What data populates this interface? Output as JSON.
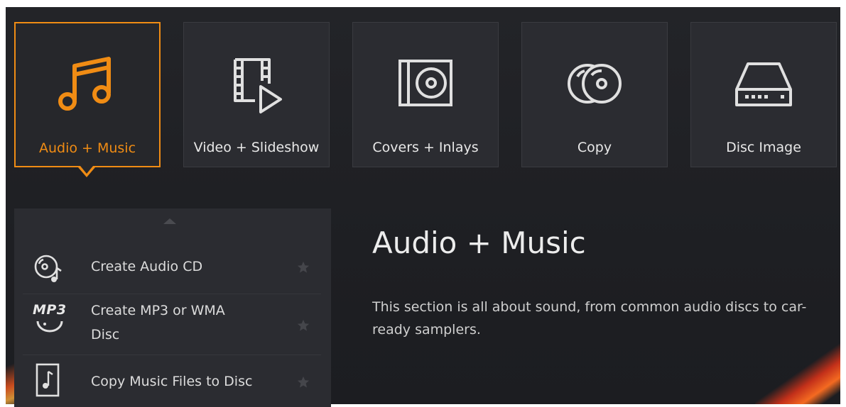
{
  "categories": [
    {
      "label": "Audio + Music",
      "icon": "music-notes-icon",
      "selected": true
    },
    {
      "label": "Video + Slideshow",
      "icon": "video-film-icon",
      "selected": false
    },
    {
      "label": "Covers + Inlays",
      "icon": "disc-cover-icon",
      "selected": false
    },
    {
      "label": "Copy",
      "icon": "copy-discs-icon",
      "selected": false
    },
    {
      "label": "Disc Image",
      "icon": "disc-drive-icon",
      "selected": false
    }
  ],
  "tasks": [
    {
      "label": "Create Audio CD",
      "icon": "audio-cd-icon"
    },
    {
      "label": "Create MP3 or WMA Disc",
      "label_line1": "Create MP3 or WMA",
      "label_line2": "Disc",
      "icon": "mp3-disc-icon",
      "icon_text": "MP3"
    },
    {
      "label": "Copy Music Files to Disc",
      "icon": "music-file-icon"
    }
  ],
  "description": {
    "title": "Audio + Music",
    "text": "This section is all about sound, from common audio discs to car-ready samplers."
  },
  "colors": {
    "accent": "#f08c14",
    "background": "#1f2024",
    "tile": "#2b2c31",
    "text": "#e6e6e6"
  }
}
